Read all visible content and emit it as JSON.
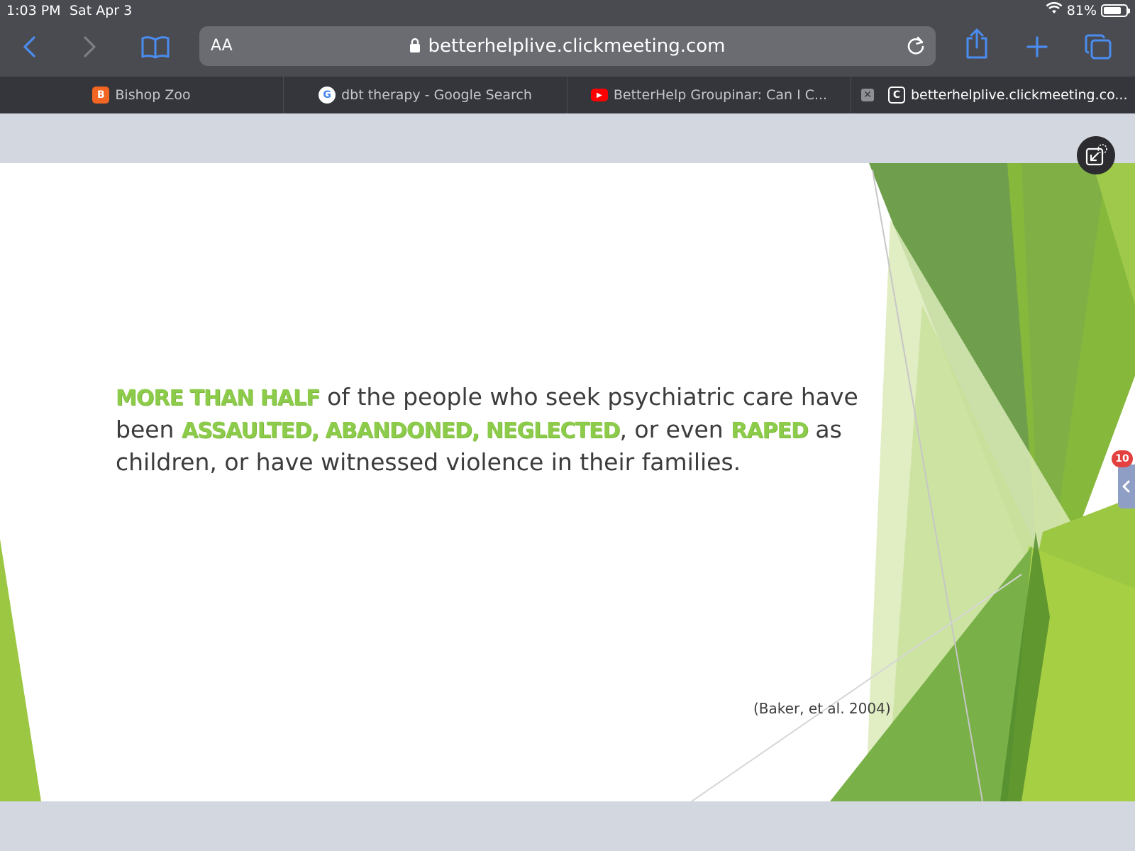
{
  "status": {
    "time": "1:03 PM",
    "date": "Sat Apr 3",
    "battery": "81%",
    "battery_level": 0.81
  },
  "toolbar": {
    "text_size_label": "AA",
    "address": "betterhelplive.clickmeeting.com",
    "icons": [
      "back-icon",
      "forward-icon",
      "bookmarks-icon",
      "lock-icon",
      "reload-icon",
      "share-icon",
      "new-tab-icon",
      "tabs-icon"
    ]
  },
  "tabs": [
    {
      "label": "Bishop Zoo",
      "favicon": "B",
      "favicon_color": "#f26522"
    },
    {
      "label": "dbt therapy - Google Search",
      "favicon": "G",
      "favicon_color": "#ffffff"
    },
    {
      "label": "BetterHelp Groupinar: Can I C...",
      "favicon": "▶",
      "favicon_color": "#ff0000"
    },
    {
      "label": "betterhelplive.clickmeeting.co...",
      "favicon": "C",
      "favicon_color": "#35363b"
    }
  ],
  "slide": {
    "quote": {
      "p1_hl": "MORE THAN HALF",
      "p1": " of the people who seek psychiatric care have been ",
      "p2_hl": "ASSAULTED, ABANDONED, NEGLECTED",
      "p2": ", or even ",
      "p3_hl": "RAPED",
      "p3": " as children, or have witnessed violence in their families."
    },
    "citation": "(Baker, et al. 2004)",
    "accent_color": "#8dcb4a"
  },
  "side_panel": {
    "badge": "10"
  }
}
